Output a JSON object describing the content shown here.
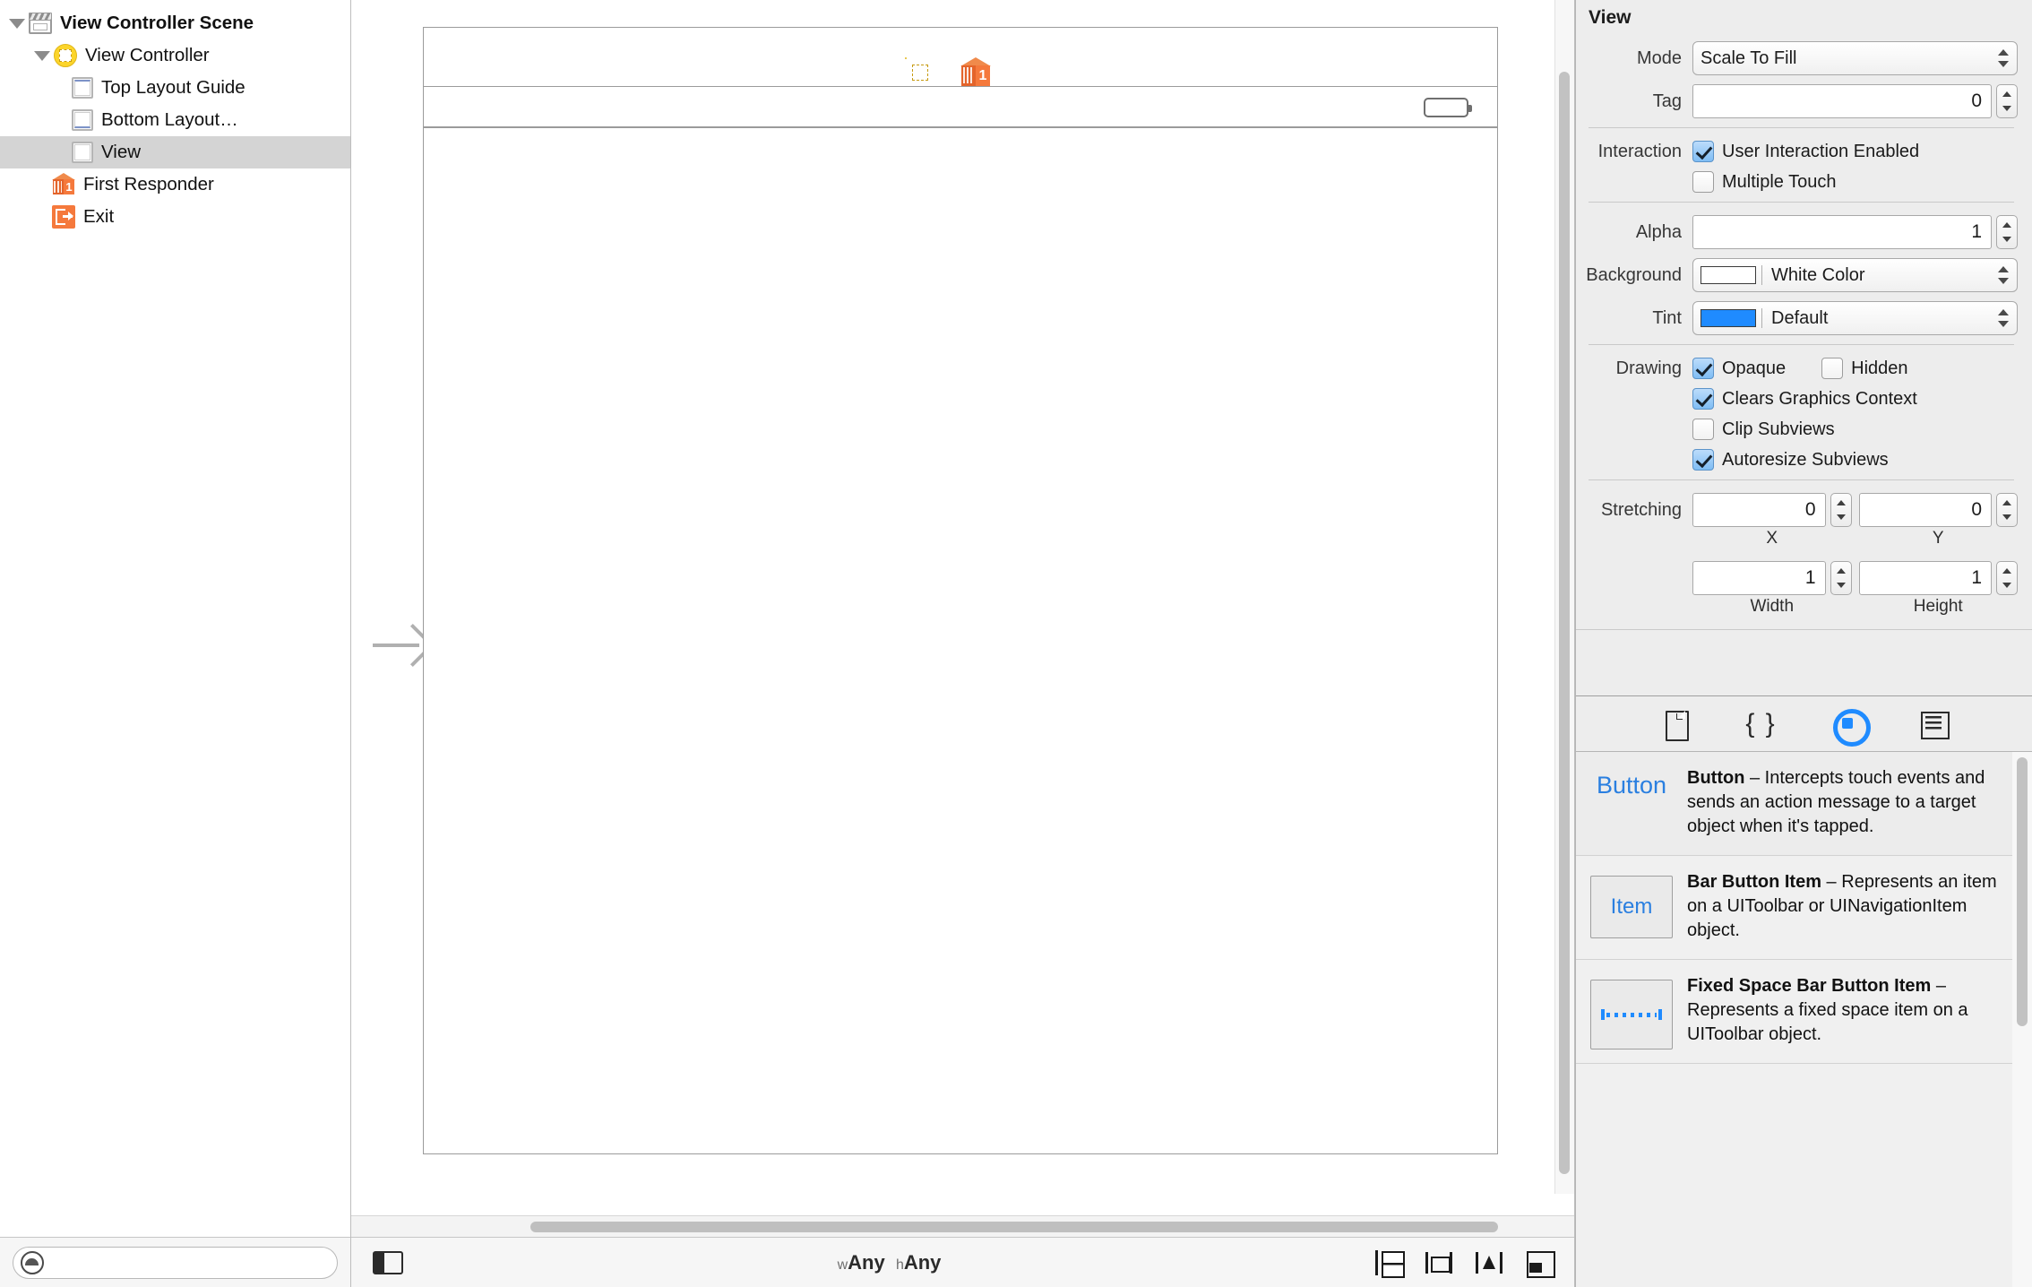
{
  "outline": {
    "items": [
      {
        "label": "View Controller Scene",
        "icon": "scene-icon",
        "indent": 0,
        "disclosure": "open",
        "bold": true,
        "selected": false
      },
      {
        "label": "View Controller",
        "icon": "view-controller-icon",
        "indent": 1,
        "disclosure": "open",
        "bold": false,
        "selected": false
      },
      {
        "label": "Top Layout Guide",
        "icon": "top-layout-guide-icon",
        "indent": 2,
        "disclosure": "none",
        "bold": false,
        "selected": false
      },
      {
        "label": "Bottom Layout…",
        "icon": "bottom-layout-guide-icon",
        "indent": 2,
        "disclosure": "none",
        "bold": false,
        "selected": false
      },
      {
        "label": "View",
        "icon": "view-icon",
        "indent": 2,
        "disclosure": "none",
        "bold": false,
        "selected": true
      },
      {
        "label": "First Responder",
        "icon": "first-responder-icon",
        "indent": 1,
        "disclosure": "none",
        "bold": false,
        "selected": false
      },
      {
        "label": "Exit",
        "icon": "exit-icon",
        "indent": 1,
        "disclosure": "none",
        "bold": false,
        "selected": false
      }
    ],
    "filter_placeholder": ""
  },
  "canvas": {
    "dock_icons": [
      "view-controller-icon",
      "first-responder-icon",
      "exit-icon"
    ],
    "entry_arrow": "initial-view-controller-arrow"
  },
  "bottom_bar": {
    "size_class_w_prefix": "w",
    "size_class_w_value": "Any",
    "size_class_h_prefix": "h",
    "size_class_h_value": "Any",
    "autolayout_buttons": [
      "stack-button",
      "align-button",
      "pin-button",
      "resolve-issues-button"
    ]
  },
  "inspector": {
    "title": "View",
    "mode": {
      "label": "Mode",
      "value": "Scale To Fill"
    },
    "tag": {
      "label": "Tag",
      "value": "0"
    },
    "interaction": {
      "label": "Interaction",
      "user_interaction_enabled": {
        "label": "User Interaction Enabled",
        "checked": true
      },
      "multiple_touch": {
        "label": "Multiple Touch",
        "checked": false
      }
    },
    "alpha": {
      "label": "Alpha",
      "value": "1"
    },
    "background": {
      "label": "Background",
      "value": "White Color",
      "swatch": "#ffffff"
    },
    "tint": {
      "label": "Tint",
      "value": "Default",
      "swatch": "#1f8bff"
    },
    "drawing": {
      "label": "Drawing",
      "opaque": {
        "label": "Opaque",
        "checked": true
      },
      "hidden": {
        "label": "Hidden",
        "checked": false
      },
      "clears_graphics_context": {
        "label": "Clears Graphics Context",
        "checked": true
      },
      "clip_subviews": {
        "label": "Clip Subviews",
        "checked": false
      },
      "autoresize_subviews": {
        "label": "Autoresize Subviews",
        "checked": true
      }
    },
    "stretching": {
      "label": "Stretching",
      "x": {
        "sub_label": "X",
        "value": "0"
      },
      "y": {
        "sub_label": "Y",
        "value": "0"
      },
      "width": {
        "sub_label": "Width",
        "value": "1"
      },
      "height": {
        "sub_label": "Height",
        "value": "1"
      }
    }
  },
  "library": {
    "tabs": [
      "file-template-icon",
      "code-snippet-icon",
      "object-library-icon",
      "media-library-icon"
    ],
    "selected_tab_index": 2,
    "items": [
      {
        "thumb_label": "Button",
        "title": "Button",
        "dash": " – ",
        "description": "Intercepts touch events and sends an action message to a target object when it's tapped.",
        "thumb_type": "text"
      },
      {
        "thumb_label": "Item",
        "title": "Bar Button Item",
        "dash": " – ",
        "description": "Represents an item on a UIToolbar or UINavigationItem object.",
        "thumb_type": "box"
      },
      {
        "thumb_label": "",
        "title": "Fixed Space Bar Button Item",
        "dash": " – ",
        "description": "Represents a fixed space item on a UIToolbar object.",
        "thumb_type": "dots"
      }
    ]
  },
  "colors": {
    "accent": "#1f8bff",
    "selection": "#d4d4d4",
    "panel_bg": "#ededed",
    "orange": "#f5793c",
    "yellow": "#fcd52b"
  }
}
